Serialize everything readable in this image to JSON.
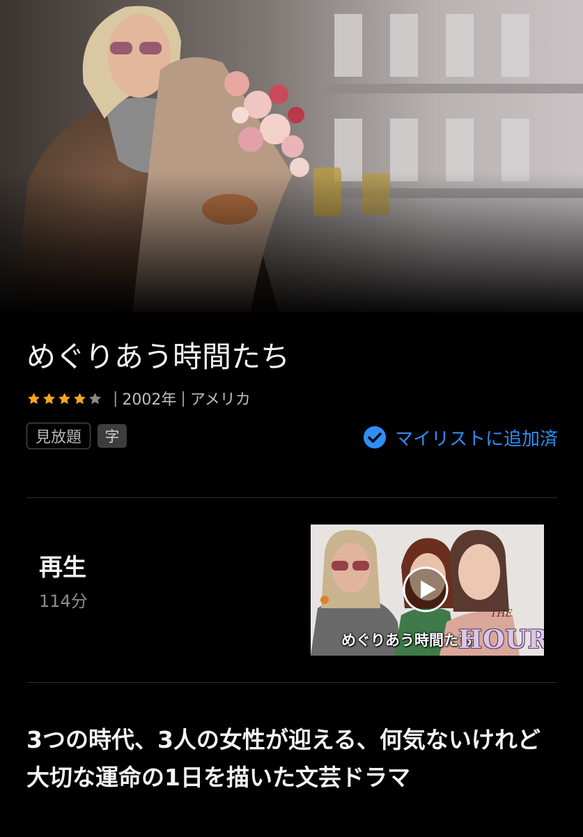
{
  "movie": {
    "title": "めぐりあう時間たち",
    "rating_stars": 4,
    "rating_max": 5,
    "year": "2002年",
    "country": "アメリカ",
    "separator": "|"
  },
  "badges": {
    "availability": "見放題",
    "subtitle": "字"
  },
  "mylist": {
    "label": "マイリストに追加済",
    "icon": "check-circle-icon"
  },
  "play": {
    "label": "再生",
    "duration": "114分",
    "thumbnail_title": "めぐりあう時間たち",
    "thumbnail_logo_small": "THE",
    "thumbnail_logo": "HOURS"
  },
  "description": "3つの時代、3人の女性が迎える、何気ないけれど大切な運命の1日を描いた文芸ドラマ",
  "colors": {
    "background": "#000000",
    "accent": "#2f8ef5",
    "star": "#f5a623",
    "star_empty": "#8a8a8a"
  }
}
